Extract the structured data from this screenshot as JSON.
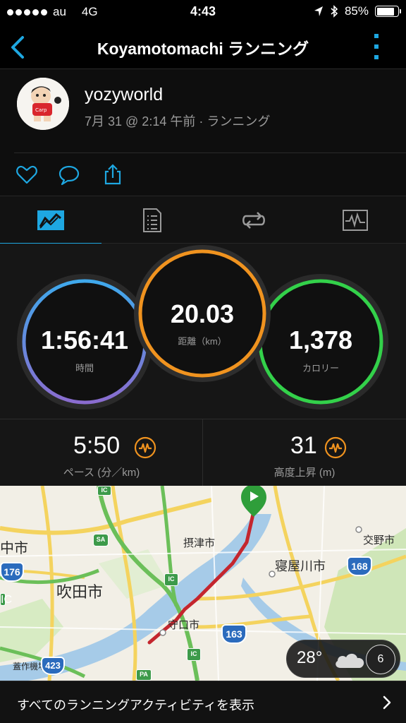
{
  "status": {
    "carrier": "au",
    "network": "4G",
    "time": "4:43",
    "battery": "85%",
    "battery_level": 0.85
  },
  "nav": {
    "title": "Koyamotomachi ランニング"
  },
  "activity": {
    "username": "yozyworld",
    "meta": "7月 31 @ 2:14 午前 · ランニング"
  },
  "stats": {
    "time_value": "1:56:41",
    "time_label": "時間",
    "distance_value": "20.03",
    "distance_label": "距離（km）",
    "calories_value": "1,378",
    "calories_label": "カロリー"
  },
  "metrics": {
    "pace_value": "5:50",
    "pace_label": "ペース (分／km)",
    "elevation_value": "31",
    "elevation_label": "高度上昇 (m)"
  },
  "map": {
    "labels": {
      "nakashi": "中市",
      "settsu": "摂津市",
      "neyagawa": "寝屋川市",
      "katano": "交野市",
      "suita": "吹田市",
      "moriguchi": "守口市",
      "toyonaka": "蓋作機場"
    },
    "shields": {
      "r176": "176",
      "r168": "168",
      "r163": "163",
      "r423": "423",
      "sa": "SA",
      "ic1": "IC",
      "ic2": "IC",
      "ic3": "IC",
      "ic4": "IC",
      "pa": "PA"
    },
    "weather_temp": "28°",
    "wind_speed": "6"
  },
  "footer": {
    "text": "すべてのランニングアクティビティを表示"
  },
  "colors": {
    "accent": "#1ea7e1",
    "time_ring": "#4aa3e8",
    "distance_ring": "#f0931f",
    "calories_ring": "#33d14a",
    "route": "#c4262e"
  },
  "icons": {
    "back": "chevron-left-icon",
    "more": "vertical-dots-icon",
    "like": "heart-icon",
    "comment": "speech-bubble-icon",
    "share": "share-icon",
    "tab_stats": "chart-icon",
    "tab_details": "document-icon",
    "tab_laps": "loop-icon",
    "tab_graph": "pulse-icon",
    "metric": "wave-icon",
    "weather": "cloud-icon",
    "footer": "chevron-right-icon"
  }
}
